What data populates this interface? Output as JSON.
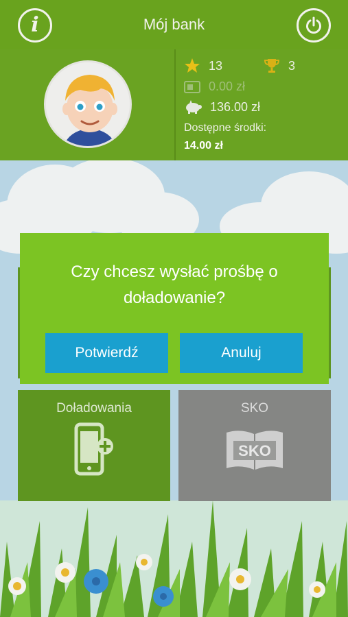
{
  "header": {
    "title": "Mój bank",
    "info_icon": "info-icon",
    "power_icon": "power-icon"
  },
  "profile": {
    "avatar": "child-avatar",
    "stars": "13",
    "trophies": "3",
    "card_balance": "0.00 zł",
    "savings_balance": "136.00 zł",
    "available_label": "Dostępne środki:",
    "available_value": "14.00 zł"
  },
  "tiles": [
    {
      "label": "Doładowania",
      "icon": "phone-add-icon"
    },
    {
      "label": "SKO",
      "icon": "sko-book-icon",
      "badge": "SKO"
    }
  ],
  "dialog": {
    "message": "Czy chcesz wysłać prośbę o doładowanie?",
    "confirm_label": "Potwierdź",
    "cancel_label": "Anuluj"
  },
  "colors": {
    "header_green": "#69a31e",
    "dialog_green": "#7cc423",
    "button_blue": "#1aa0cf",
    "tile_grey": "#858684"
  }
}
